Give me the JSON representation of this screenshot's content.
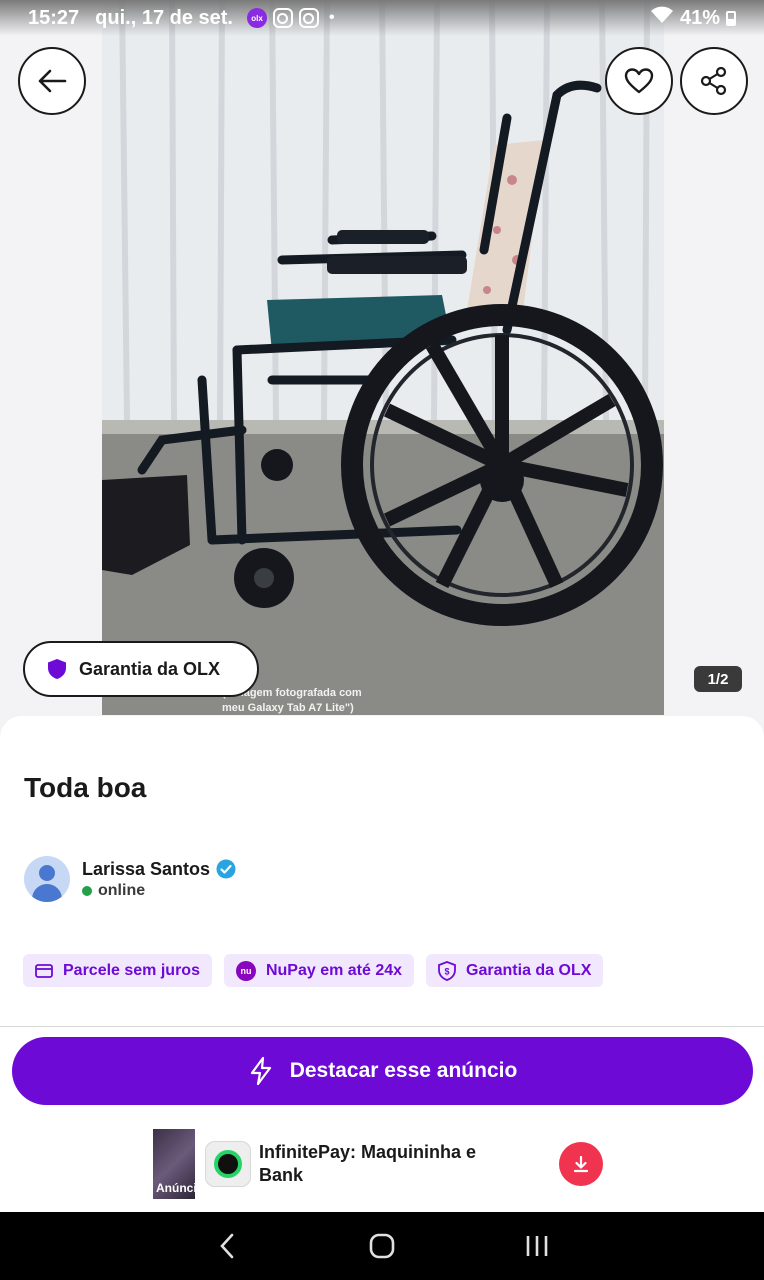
{
  "status_bar": {
    "time": "15:27",
    "date": "qui., 17 de set.",
    "olx_badge": "olx",
    "battery": "41%"
  },
  "photo": {
    "caption_line1": "(\"Imagem fotografada com",
    "caption_line2": "meu Galaxy Tab A7 Lite\")",
    "counter": "1/2",
    "guarantee_label": "Garantia da OLX"
  },
  "listing": {
    "title": "Toda boa"
  },
  "seller": {
    "name": "Larissa Santos",
    "status": "online"
  },
  "chips": [
    {
      "label": "Parcele sem juros",
      "icon": "card-icon"
    },
    {
      "label": "NuPay em até 24x",
      "icon": "nu-icon",
      "icon_text": "nu"
    },
    {
      "label": "Garantia da OLX",
      "icon": "shield-dollar-icon"
    }
  ],
  "cta": {
    "label": "Destacar esse anúncio"
  },
  "ad": {
    "badge": "Anúncios",
    "title": "InfinitePay: Maquininha e Bank"
  },
  "colors": {
    "brand_purple": "#6e0ad6",
    "chip_bg": "#f1e8fd",
    "online_green": "#24a148",
    "download_red": "#f0344f"
  }
}
